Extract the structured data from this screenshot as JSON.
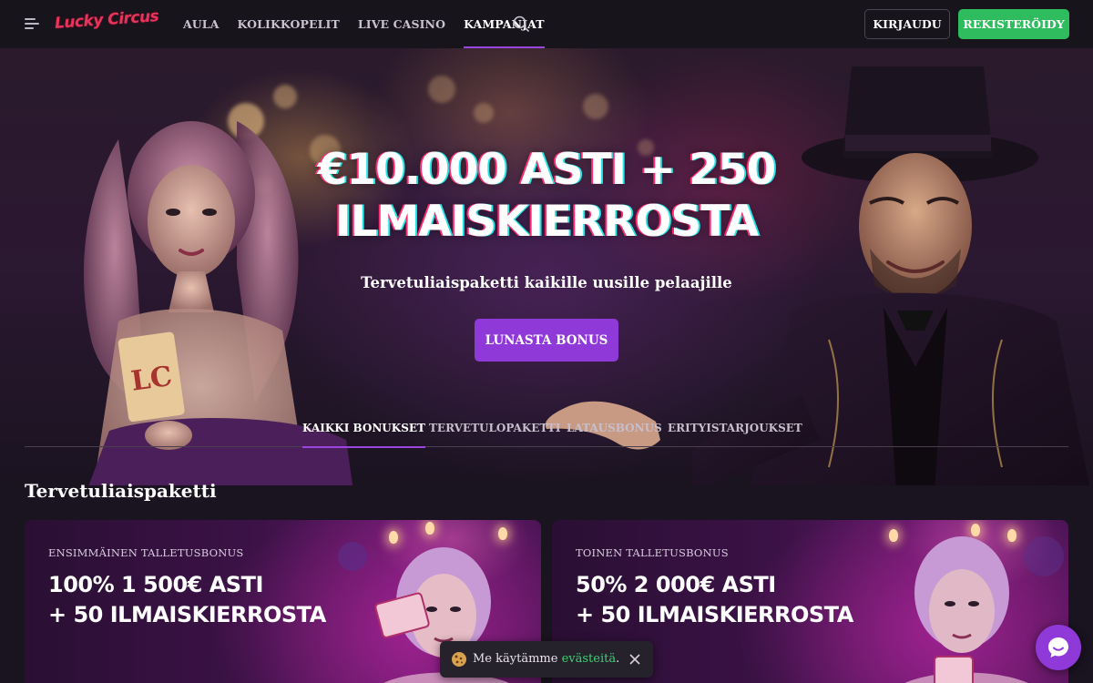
{
  "header": {
    "logo_text": "Lucky Circus",
    "nav": [
      "AULA",
      "KOLIKKOPELIT",
      "LIVE CASINO",
      "KAMPANJAT"
    ],
    "active_nav": "KAMPANJAT",
    "login_label": "KIRJAUDU",
    "register_label": "REKISTERÖIDY",
    "icons": {
      "menu": "hamburger-menu-icon",
      "search": "search-icon"
    }
  },
  "hero": {
    "title_line1": "€10.000 ASTI + 250",
    "title_line2": "ILMAISKIERROSTA",
    "subtitle": "Tervetuliaispaketti kaikille uusille pelaajille",
    "cta_label": "LUNASTA BONUS",
    "card_logo_text": "LC"
  },
  "bonus_tabs": {
    "items": [
      "KAIKKI BONUKSET",
      "TERVETULOPAKETTI",
      "LATAUSBONUS",
      "ERITYISTARJOUKSET"
    ],
    "active": "KAIKKI BONUKSET"
  },
  "section": {
    "title": "Tervetuliaispaketti",
    "cards": [
      {
        "label": "ENSIMMÄINEN TALLETUSBONUS",
        "offer_line1": "100% 1 500€ ASTI",
        "offer_line2": "+ 50 ILMAISKIERROSTA"
      },
      {
        "label": "TOINEN TALLETUSBONUS",
        "offer_line1": "50% 2 000€ ASTI",
        "offer_line2": "+ 50 ILMAISKIERROSTA"
      }
    ]
  },
  "cookie": {
    "text": "Me käytämme ",
    "link": "evästeitä",
    "suffix": ".",
    "icons": {
      "cookie": "cookie-icon",
      "close": "close-icon"
    }
  },
  "chat": {
    "icon": "chat-icon"
  },
  "colors": {
    "accent_purple": "#8f39d8",
    "register_green": "#2ebc5e",
    "logo_red": "#e8335a",
    "header_bg": "#17141b"
  }
}
